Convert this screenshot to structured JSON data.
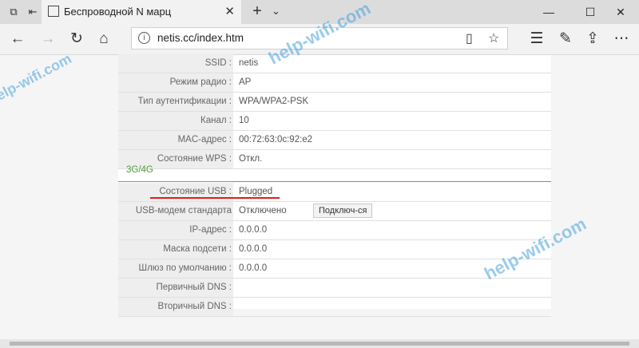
{
  "browser": {
    "tab_title": "Беспроводной N марц",
    "url": "netis.cc/index.htm",
    "icons": {
      "tab_manager": "tabs-icon",
      "set_aside": "set-aside-icon",
      "favicon": "page-icon",
      "close": "close-icon",
      "new_tab": "plus-icon",
      "tab_menu": "chevron-down-icon",
      "back": "arrow-left-icon",
      "forward": "arrow-right-icon",
      "refresh": "refresh-icon",
      "home": "home-icon",
      "info": "info-icon",
      "reading_view": "book-icon",
      "favorite": "star-icon",
      "favorites_list": "favorites-list-icon",
      "notes": "pen-icon",
      "share": "share-icon",
      "more": "more-icon",
      "minimize": "minimize-icon",
      "maximize": "maximize-icon",
      "window_close": "close-icon"
    }
  },
  "status": {
    "wireless_rows": [
      {
        "label": "SSID :",
        "value": "netis"
      },
      {
        "label": "Режим радио :",
        "value": "AP"
      },
      {
        "label": "Тип аутентификации :",
        "value": "WPA/WPA2-PSK"
      },
      {
        "label": "Канал :",
        "value": "10"
      },
      {
        "label": "MAC-адрес :",
        "value": "00:72:63:0c:92:e2"
      },
      {
        "label": "Состояние WPS :",
        "value": "Откл."
      }
    ],
    "section_3g": "3G/4G",
    "usb_rows": [
      {
        "label": "Состояние USB :",
        "value": "Plugged"
      },
      {
        "label": "USB-модем стандарта",
        "value": "Отключено"
      },
      {
        "label": "IP-адрес :",
        "value": "0.0.0.0"
      },
      {
        "label": "Маска подсети :",
        "value": "0.0.0.0"
      },
      {
        "label": "Шлюз по умолчанию :",
        "value": "0.0.0.0"
      },
      {
        "label": "Первичный DNS :",
        "value": ""
      },
      {
        "label": "Вторичный DNS :",
        "value": ""
      }
    ],
    "connect_button": "Подключ-ся"
  },
  "watermarks": [
    "help-wifi.com",
    "help-wifi.com",
    "help-wifi.com"
  ],
  "colors": {
    "section_green": "#4e9a3c",
    "annotation_red": "#e21c1c",
    "watermark": "#46a0dc"
  }
}
